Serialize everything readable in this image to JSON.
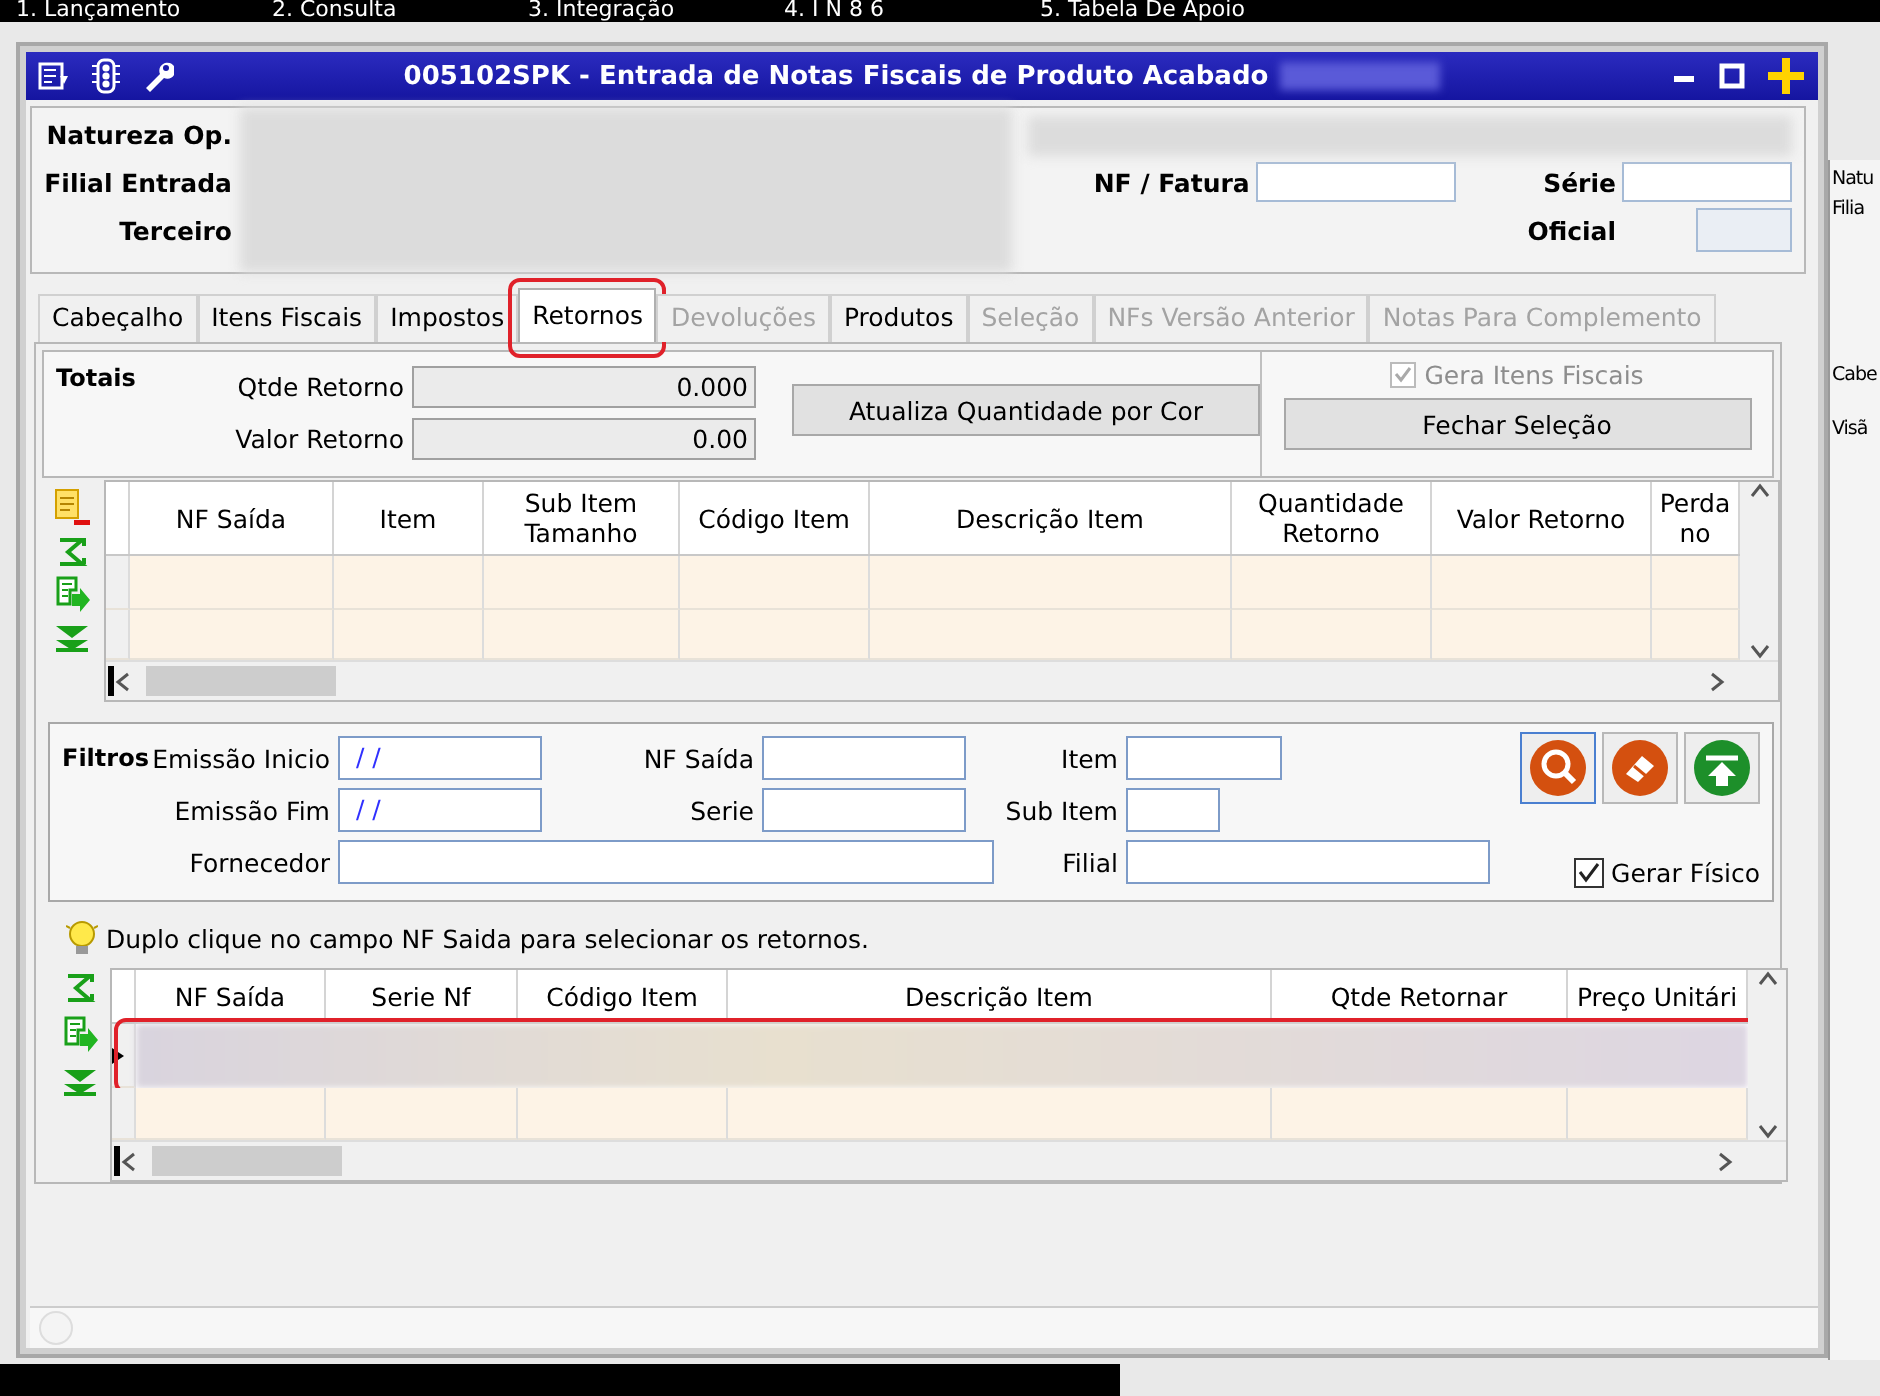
{
  "menu_bar": {
    "items": [
      "1. Lançamento",
      "2. Consulta",
      "3. Integração",
      "4. I N 8 6",
      "5. Tabela De Apoio"
    ]
  },
  "background_window": {
    "labels": [
      "Natu",
      "Filia",
      "Cabe",
      "Visã"
    ]
  },
  "window": {
    "title": "005102SPK - Entrada de Notas Fiscais de Produto Acabado"
  },
  "header": {
    "labels": [
      "Natureza Op.",
      "Filial Entrada",
      "Terceiro"
    ],
    "nf_fatura": "NF / Fatura",
    "serie": "Série",
    "oficial": "Oficial"
  },
  "tabs": [
    {
      "label": "Cabeçalho",
      "selected": false,
      "disabled": false,
      "highlighted": false
    },
    {
      "label": "Itens Fiscais",
      "selected": false,
      "disabled": false,
      "highlighted": false
    },
    {
      "label": "Impostos",
      "selected": false,
      "disabled": false,
      "highlighted": false
    },
    {
      "label": "Retornos",
      "selected": true,
      "disabled": false,
      "highlighted": true
    },
    {
      "label": "Devoluções",
      "selected": false,
      "disabled": true,
      "highlighted": false
    },
    {
      "label": "Produtos",
      "selected": false,
      "disabled": false,
      "highlighted": false
    },
    {
      "label": "Seleção",
      "selected": false,
      "disabled": true,
      "highlighted": false
    },
    {
      "label": "NFs Versão Anterior",
      "selected": false,
      "disabled": true,
      "highlighted": false
    },
    {
      "label": "Notas Para Complemento",
      "selected": false,
      "disabled": true,
      "highlighted": false
    }
  ],
  "totals": {
    "title": "Totais",
    "fields": [
      {
        "label": "Qtde Retorno",
        "value": "0.000"
      },
      {
        "label": "Valor Retorno",
        "value": "0.00"
      }
    ],
    "update_button": "Atualiza Quantidade por Cor",
    "gera_itens_fiscais": {
      "label": "Gera Itens Fiscais",
      "checked": true,
      "disabled": true
    },
    "close_button": "Fechar Seleção"
  },
  "returns_grid": {
    "columns": [
      "NF Saída",
      "Item",
      "Sub Item Tamanho",
      "Código Item",
      "Descrição Item",
      "Quantidade Retorno",
      "Valor Retorno",
      "Perda no"
    ]
  },
  "filters": {
    "title": "Filtros",
    "fields": [
      {
        "label": "Emissão Inicio",
        "value": "/ /"
      },
      {
        "label": "NF Saída"
      },
      {
        "label": "Item"
      },
      {
        "label": "Emissão Fim",
        "value": "/ /"
      },
      {
        "label": "Serie"
      },
      {
        "label": "Sub Item"
      },
      {
        "label": "Fornecedor"
      },
      {
        "label": "Filial"
      }
    ],
    "gerar_fisico": {
      "label": "Gerar Físico",
      "checked": true
    }
  },
  "hint": "Duplo clique no campo NF Saida para selecionar os retornos.",
  "selection_grid": {
    "columns": [
      "NF Saída",
      "Serie Nf",
      "Código Item",
      "Descrição Item",
      "Qtde Retornar",
      "Preço Unitári"
    ],
    "rows": [
      {
        "selected": true,
        "highlighted": true
      },
      {
        "selected": false,
        "highlighted": false
      }
    ]
  }
}
